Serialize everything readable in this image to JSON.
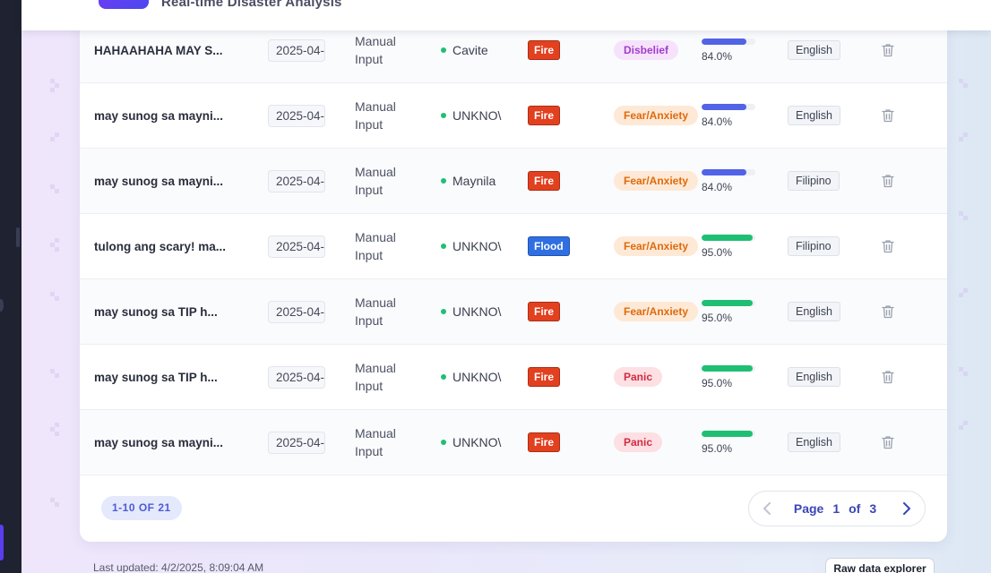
{
  "header": {
    "subtitle": "Real-time Disaster Analysis"
  },
  "rows": [
    {
      "text": "HAHAAHAHA MAY S...",
      "date": "2025-04-",
      "source": "Manual Input",
      "location": "Cavite",
      "type": "Fire",
      "sentiment": "Disbelief",
      "confidence": 0.84,
      "confidence_label": "84.0%",
      "language": "English"
    },
    {
      "text": "may sunog sa mayni...",
      "date": "2025-04-",
      "source": "Manual Input",
      "location": "UNKNO\\",
      "type": "Fire",
      "sentiment": "Fear/Anxiety",
      "confidence": 0.84,
      "confidence_label": "84.0%",
      "language": "English"
    },
    {
      "text": "may sunog sa mayni...",
      "date": "2025-04-",
      "source": "Manual Input",
      "location": "Maynila",
      "type": "Fire",
      "sentiment": "Fear/Anxiety",
      "confidence": 0.84,
      "confidence_label": "84.0%",
      "language": "Filipino"
    },
    {
      "text": "tulong ang scary! ma...",
      "date": "2025-04-",
      "source": "Manual Input",
      "location": "UNKNO\\",
      "type": "Flood",
      "sentiment": "Fear/Anxiety",
      "confidence": 0.95,
      "confidence_label": "95.0%",
      "language": "Filipino"
    },
    {
      "text": "may sunog sa TIP h...",
      "date": "2025-04-",
      "source": "Manual Input",
      "location": "UNKNO\\",
      "type": "Fire",
      "sentiment": "Fear/Anxiety",
      "confidence": 0.95,
      "confidence_label": "95.0%",
      "language": "English"
    },
    {
      "text": "may sunog sa TIP h...",
      "date": "2025-04-",
      "source": "Manual Input",
      "location": "UNKNO\\",
      "type": "Fire",
      "sentiment": "Panic",
      "confidence": 0.95,
      "confidence_label": "95.0%",
      "language": "English"
    },
    {
      "text": "may sunog sa mayni...",
      "date": "2025-04-",
      "source": "Manual Input",
      "location": "UNKNO\\",
      "type": "Fire",
      "sentiment": "Panic",
      "confidence": 0.95,
      "confidence_label": "95.0%",
      "language": "English"
    }
  ],
  "colors": {
    "type": {
      "Fire": "#e2401f",
      "Flood": "#2f6fe3"
    },
    "sentiment": {
      "Disbelief": {
        "bg": "#f6e3fb",
        "fg": "#a23ccf"
      },
      "Fear/Anxiety": {
        "bg": "#fde9d6",
        "fg": "#e06a0c"
      },
      "Panic": {
        "bg": "#fde0e3",
        "fg": "#d12c43"
      }
    },
    "confidence_low": "#5163e6",
    "confidence_high": "#1fbf73"
  },
  "pagination": {
    "range_label": "1-10 OF 21",
    "page_word": "Page",
    "current_page": "1",
    "of_word": "of",
    "total_pages": "3"
  },
  "footer": {
    "last_updated": "Last updated: 4/2/2025, 8:09:04 AM",
    "raw_button": "Raw data explorer"
  },
  "icons": {
    "delete": "trash-icon",
    "prev": "chevron-left-icon",
    "next": "chevron-right-icon"
  }
}
